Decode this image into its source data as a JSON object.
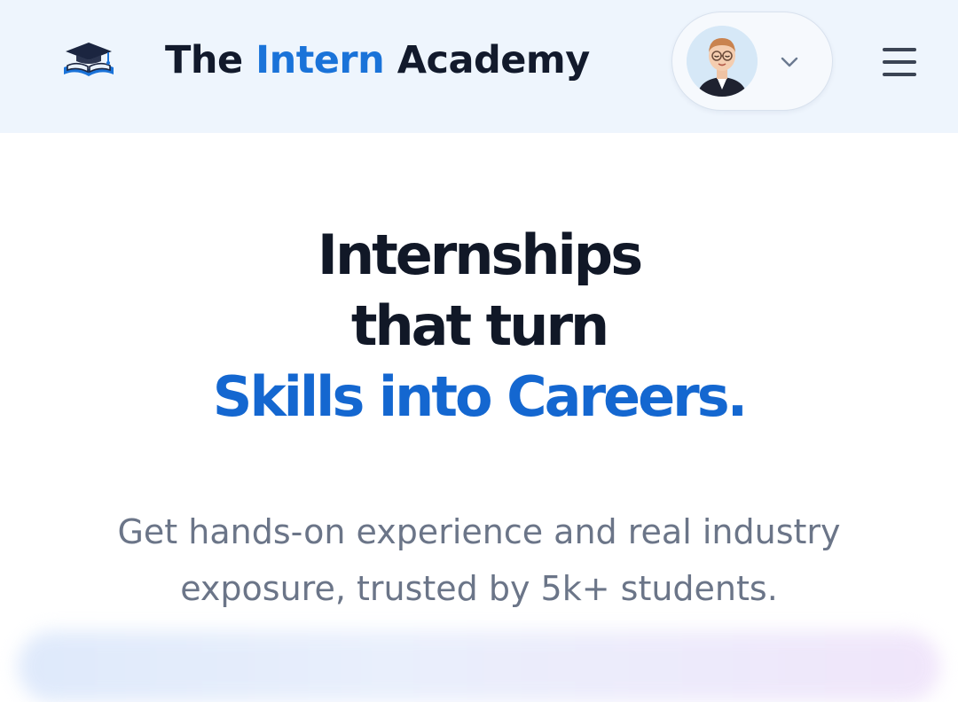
{
  "header": {
    "brand": {
      "part1": "The ",
      "part2": "Intern",
      "part3": " Academy"
    },
    "logo_icon": "graduation-cap-book-icon",
    "profile": {
      "avatar_icon": "user-avatar",
      "dropdown_icon": "chevron-down-icon"
    },
    "menu_icon": "hamburger-menu-icon"
  },
  "hero": {
    "line1": "Internships",
    "line2": "that turn",
    "line3": "Skills into Careers.",
    "subtitle_line1": "Get hands-on experience and real industry",
    "subtitle_line2": "exposure, trusted by 5k+ students."
  },
  "colors": {
    "header_bg": "#eef5fd",
    "accent": "#1a73d9",
    "title_dark": "#111827",
    "subtitle_gray": "#6b7588"
  }
}
